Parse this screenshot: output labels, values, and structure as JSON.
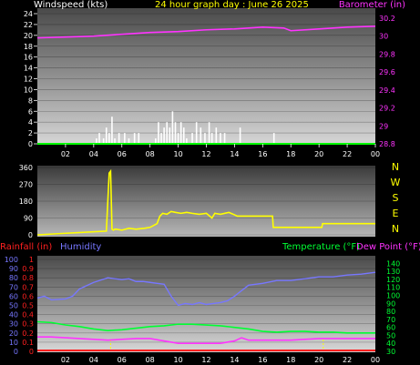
{
  "chart_data": [
    {
      "type": "bar+line",
      "title": "24 hour graph day : June 26 2025",
      "left_axis": {
        "label": "Windspeed (kts)",
        "ticks": [
          "0",
          "2",
          "4",
          "6",
          "8",
          "10",
          "12",
          "14",
          "16",
          "18",
          "20",
          "22",
          "24"
        ],
        "range": [
          0,
          24
        ]
      },
      "right_axis": {
        "label": "Barometer (in)",
        "ticks": [
          "28.8",
          "29",
          "29.2",
          "29.4",
          "29.6",
          "29.8",
          "30",
          "30.2"
        ],
        "range": [
          28.8,
          30.25
        ]
      },
      "x_ticks": [
        "02",
        "04",
        "06",
        "08",
        "10",
        "12",
        "14",
        "16",
        "18",
        "20",
        "22",
        "00"
      ],
      "colors": {
        "wind": "#ffffff",
        "baro": "#ff33ff",
        "wind_label": "#ffffff",
        "baro_label": "#ff33ff",
        "title": "#ffff00",
        "ground": "#00ff00"
      },
      "barometer_x": [
        0,
        2,
        4,
        6,
        8,
        10,
        12,
        14,
        16,
        17.5,
        18,
        20,
        22,
        24
      ],
      "barometer_y": [
        29.98,
        29.99,
        30.0,
        30.02,
        30.04,
        30.05,
        30.07,
        30.08,
        30.1,
        30.09,
        30.06,
        30.08,
        30.1,
        30.11
      ],
      "wind_bars": [
        {
          "x": 4.2,
          "v": 1
        },
        {
          "x": 4.4,
          "v": 2
        },
        {
          "x": 4.7,
          "v": 1
        },
        {
          "x": 4.9,
          "v": 3
        },
        {
          "x": 5.1,
          "v": 2
        },
        {
          "x": 5.3,
          "v": 5
        },
        {
          "x": 5.5,
          "v": 1
        },
        {
          "x": 5.8,
          "v": 2
        },
        {
          "x": 6.2,
          "v": 2
        },
        {
          "x": 6.5,
          "v": 1
        },
        {
          "x": 6.9,
          "v": 2
        },
        {
          "x": 7.2,
          "v": 2
        },
        {
          "x": 8.4,
          "v": 1
        },
        {
          "x": 8.6,
          "v": 4
        },
        {
          "x": 8.8,
          "v": 2
        },
        {
          "x": 9.0,
          "v": 3
        },
        {
          "x": 9.2,
          "v": 4
        },
        {
          "x": 9.4,
          "v": 3
        },
        {
          "x": 9.6,
          "v": 6
        },
        {
          "x": 9.8,
          "v": 4
        },
        {
          "x": 10.0,
          "v": 2
        },
        {
          "x": 10.2,
          "v": 4
        },
        {
          "x": 10.4,
          "v": 3
        },
        {
          "x": 10.6,
          "v": 1
        },
        {
          "x": 11.0,
          "v": 2
        },
        {
          "x": 11.3,
          "v": 4
        },
        {
          "x": 11.6,
          "v": 3
        },
        {
          "x": 11.9,
          "v": 2
        },
        {
          "x": 12.2,
          "v": 4
        },
        {
          "x": 12.4,
          "v": 2
        },
        {
          "x": 12.7,
          "v": 3
        },
        {
          "x": 13.0,
          "v": 2
        },
        {
          "x": 13.3,
          "v": 2
        },
        {
          "x": 14.4,
          "v": 3
        },
        {
          "x": 16.8,
          "v": 2
        }
      ]
    },
    {
      "type": "line",
      "title": "",
      "compass_letters": [
        "N",
        "W",
        "S",
        "E",
        "N"
      ],
      "left_axis": {
        "ticks": [
          "0",
          "90",
          "180",
          "270",
          "360"
        ],
        "range": [
          0,
          360
        ]
      },
      "colors": {
        "dir": "#ffff00",
        "compass": "#ffff00"
      },
      "direction_x": [
        0,
        4.9,
        5.1,
        5.2,
        5.3,
        5.4,
        5.5,
        5.6,
        6.0,
        6.5,
        7.0,
        7.6,
        8.0,
        8.5,
        8.7,
        8.9,
        9.2,
        9.5,
        9.8,
        10.2,
        10.6,
        11.0,
        11.5,
        12.0,
        12.4,
        12.6,
        13.0,
        13.6,
        14.2,
        14.6,
        16.7,
        16.75,
        20.2,
        20.25,
        24
      ],
      "direction_y": [
        0,
        20,
        330,
        340,
        30,
        25,
        30,
        30,
        25,
        35,
        30,
        35,
        40,
        60,
        100,
        115,
        110,
        125,
        120,
        115,
        120,
        115,
        110,
        115,
        90,
        115,
        110,
        120,
        100,
        100,
        100,
        40,
        40,
        60,
        60
      ]
    },
    {
      "type": "line",
      "title": "",
      "labels": {
        "rainfall": "Rainfall (in)",
        "humidity": "Humidity",
        "temperature": "Temperature (°F)",
        "dew_point": "Dew Point (°F)"
      },
      "colors": {
        "rainfall": "#ff2020",
        "humidity": "#7777ff",
        "temperature": "#00ff33",
        "dew_point": "#ff33ff"
      },
      "humidity_ticks": [
        "0",
        "10",
        "20",
        "30",
        "40",
        "50",
        "60",
        "70",
        "80",
        "90",
        "100"
      ],
      "rain_ticks": [
        "0",
        "0.1",
        "0.2",
        "0.3",
        "0.4",
        "0.5",
        "0.6",
        "0.7",
        "0.8",
        "0.9",
        "1"
      ],
      "temp_ticks": [
        "30",
        "40",
        "50",
        "60",
        "70",
        "80",
        "90",
        "100",
        "110",
        "120",
        "130",
        "140"
      ],
      "x_ticks": [
        "02",
        "04",
        "06",
        "08",
        "10",
        "12",
        "14",
        "16",
        "18",
        "20",
        "22",
        "00"
      ],
      "temp_range": [
        30,
        145
      ],
      "humidity_x": [
        0,
        0.5,
        1.0,
        2.0,
        2.5,
        3.0,
        4.0,
        5.0,
        6.0,
        6.5,
        7.0,
        7.5,
        8.0,
        8.5,
        9.0,
        9.5,
        10.0,
        10.5,
        11.0,
        11.5,
        12.0,
        12.5,
        13.0,
        13.5,
        14.0,
        14.5,
        15.0,
        16.0,
        17.0,
        18.0,
        19.0,
        20.0,
        21.0,
        22.0,
        23.0,
        24.0
      ],
      "humidity_y": [
        58,
        60,
        56,
        57,
        60,
        68,
        75,
        80,
        78,
        79,
        76,
        76,
        75,
        74,
        73,
        60,
        50,
        52,
        51,
        53,
        51,
        52,
        53,
        55,
        60,
        66,
        72,
        74,
        77,
        77,
        79,
        81,
        81,
        83,
        84,
        86
      ],
      "temperature_x": [
        0,
        1,
        2,
        3,
        4,
        5,
        6,
        7,
        8,
        9,
        10,
        11,
        12,
        13,
        14,
        15,
        16,
        17,
        18,
        19,
        20,
        21,
        22,
        23,
        24
      ],
      "temperature_y": [
        67,
        66,
        63,
        61,
        58,
        56,
        57,
        59,
        61,
        62,
        64,
        64,
        63,
        62,
        60,
        58,
        55,
        54,
        55,
        55,
        54,
        54,
        53,
        53,
        53
      ],
      "dewpoint_x": [
        0,
        1,
        2,
        3,
        4,
        5,
        6,
        7,
        8,
        9,
        10,
        11,
        12,
        13,
        14,
        14.5,
        15,
        16,
        17,
        18,
        19,
        20,
        21,
        22,
        23,
        24
      ],
      "dewpoint_y": [
        48,
        48,
        47,
        46,
        45,
        44,
        45,
        46,
        46,
        43,
        40,
        40,
        40,
        40,
        43,
        47,
        44,
        44,
        44,
        44,
        45,
        46,
        46,
        46,
        46,
        46
      ],
      "rainfall_x": [
        0,
        24
      ],
      "rainfall_y": [
        0,
        0
      ],
      "rain_markers_x": [
        5.2,
        20.3
      ]
    }
  ]
}
